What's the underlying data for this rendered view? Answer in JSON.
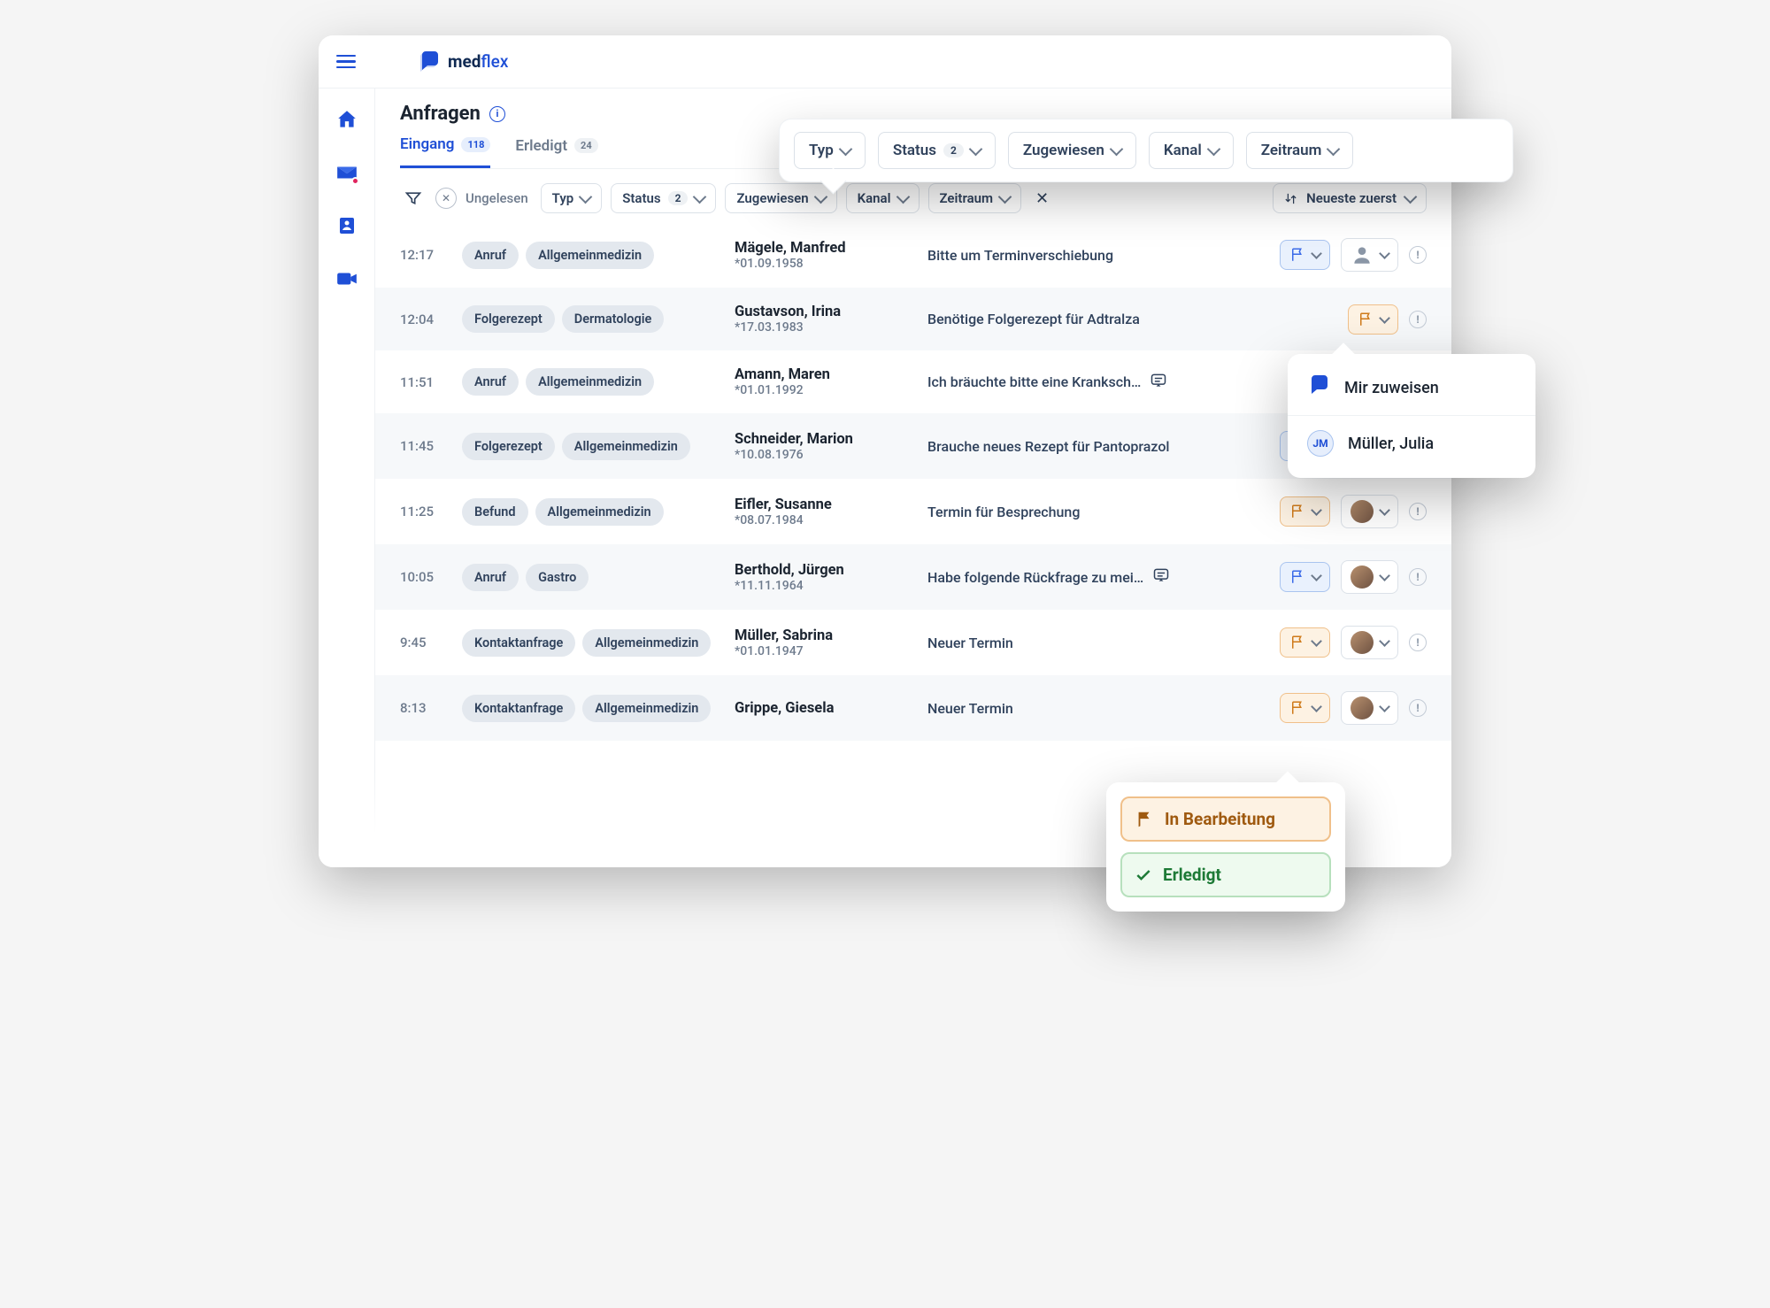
{
  "brand": {
    "name_bold": "med",
    "name_thin": "flex"
  },
  "page": {
    "title": "Anfragen"
  },
  "tabs": [
    {
      "label": "Eingang",
      "count": "118",
      "active": true
    },
    {
      "label": "Erledigt",
      "count": "24",
      "active": false
    }
  ],
  "filters_row": {
    "unread_label": "Ungelesen",
    "type": "Typ",
    "status": "Status",
    "status_count": "2",
    "assigned": "Zugewiesen",
    "channel": "Kanal",
    "period": "Zeitraum",
    "sort": "Neueste zuerst"
  },
  "float_filters": {
    "type": "Typ",
    "status": "Status",
    "status_count": "2",
    "assigned": "Zugewiesen",
    "channel": "Kanal",
    "period": "Zeitraum"
  },
  "rows": [
    {
      "time": "12:17",
      "tags": [
        "Anruf",
        "Allgemeinmedizin"
      ],
      "name": "Mägele, Manfred",
      "dob": "*01.09.1958",
      "subject": "Bitte um Terminverschiebung",
      "chat": false,
      "flag": "blue",
      "avatar": "generic"
    },
    {
      "time": "12:04",
      "tags": [
        "Folgerezept",
        "Dermatologie"
      ],
      "name": "Gustavson, Irina",
      "dob": "*17.03.1983",
      "subject": "Benötige Folgerezept für Adtralza",
      "chat": false,
      "flag": "orange",
      "avatar": "none"
    },
    {
      "time": "11:51",
      "tags": [
        "Anruf",
        "Allgemeinmedizin"
      ],
      "name": "Amann, Maren",
      "dob": "*01.01.1992",
      "subject": "Ich bräuchte bitte eine Kranksch…",
      "chat": true,
      "flag": "orange",
      "avatar": "none"
    },
    {
      "time": "11:45",
      "tags": [
        "Folgerezept",
        "Allgemeinmedizin"
      ],
      "name": "Schneider, Marion",
      "dob": "*10.08.1976",
      "subject": "Brauche neues Rezept für Pantoprazol",
      "chat": false,
      "flag": "blue",
      "avatar": "person"
    },
    {
      "time": "11:25",
      "tags": [
        "Befund",
        "Allgemeinmedizin"
      ],
      "name": "Eifler, Susanne",
      "dob": "*08.07.1984",
      "subject": "Termin für Besprechung",
      "chat": false,
      "flag": "orange",
      "avatar": "person"
    },
    {
      "time": "10:05",
      "tags": [
        "Anruf",
        "Gastro"
      ],
      "name": "Berthold, Jürgen",
      "dob": "*11.11.1964",
      "subject": "Habe folgende Rückfrage zu mei…",
      "chat": true,
      "flag": "blue",
      "avatar": "person"
    },
    {
      "time": "9:45",
      "tags": [
        "Kontaktanfrage",
        "Allgemeinmedizin"
      ],
      "name": "Müller, Sabrina",
      "dob": "*01.01.1947",
      "subject": "Neuer Termin",
      "chat": false,
      "flag": "orange",
      "avatar": "person"
    },
    {
      "time": "8:13",
      "tags": [
        "Kontaktanfrage",
        "Allgemeinmedizin"
      ],
      "name": "Grippe, Giesela",
      "dob": "",
      "subject": "Neuer Termin",
      "chat": false,
      "flag": "orange",
      "avatar": "person"
    }
  ],
  "assign_popover": {
    "self": "Mir zuweisen",
    "other_initials": "JM",
    "other_name": "Müller, Julia"
  },
  "status_popover": {
    "processing": "In Bearbeitung",
    "done": "Erledigt"
  }
}
